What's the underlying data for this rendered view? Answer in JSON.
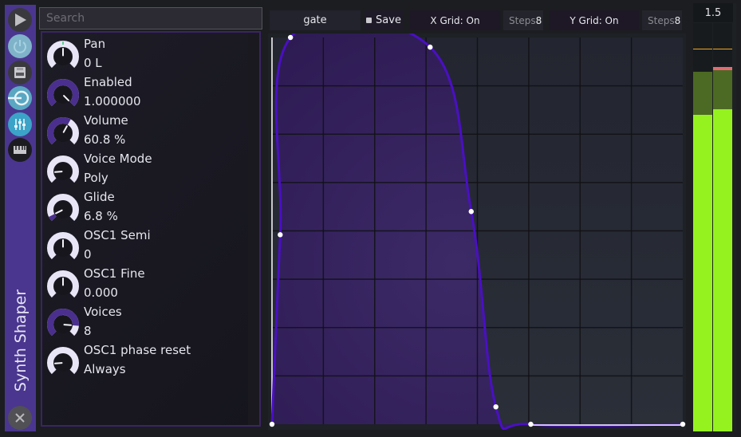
{
  "plugin": {
    "title": "Synth Shaper"
  },
  "side_strip": {
    "buttons": [
      {
        "name": "play",
        "icon": "play-icon"
      },
      {
        "name": "power",
        "icon": "power-icon"
      },
      {
        "name": "save",
        "icon": "floppy-disk-icon"
      },
      {
        "name": "routing",
        "icon": "input-routing-icon"
      },
      {
        "name": "mixer",
        "icon": "sliders-icon"
      },
      {
        "name": "keyboard",
        "icon": "piano-keyboard-icon"
      }
    ],
    "close_icon": "close-icon"
  },
  "search": {
    "placeholder": "Search",
    "value": ""
  },
  "params": [
    {
      "name": "Pan",
      "value": "0 L",
      "fill": 0.5,
      "style": "bipolar"
    },
    {
      "name": "Enabled",
      "value": "1.000000",
      "fill": 1.0,
      "style": "unipolar"
    },
    {
      "name": "Volume",
      "value": "60.8 %",
      "fill": 0.608,
      "style": "unipolar"
    },
    {
      "name": "Voice Mode",
      "value": "Poly",
      "fill": 0.15,
      "style": "none"
    },
    {
      "name": "Glide",
      "value": "6.8 %",
      "fill": 0.068,
      "style": "unipolar"
    },
    {
      "name": "OSC1 Semi",
      "value": "0",
      "fill": 0.5,
      "style": "none"
    },
    {
      "name": "OSC1 Fine",
      "value": "0.000",
      "fill": 0.5,
      "style": "none"
    },
    {
      "name": "Voices",
      "value": "8",
      "fill": 0.85,
      "style": "unipolar"
    },
    {
      "name": "OSC1 phase reset",
      "value": "Always",
      "fill": 0.15,
      "style": "none"
    }
  ],
  "toolbar": {
    "preset_name": "gate",
    "save_label": "Save",
    "x_grid_label": "X Grid: On",
    "x_steps_label": "Steps",
    "x_steps_value": "8",
    "y_grid_label": "Y Grid: On",
    "y_steps_label": "Steps",
    "y_steps_value": "8"
  },
  "shape": {
    "grid_x_steps": 8,
    "grid_y_steps": 8,
    "points": [
      {
        "x": 0.0,
        "y": 0.0
      },
      {
        "x": 0.02,
        "y": 0.49
      },
      {
        "x": 0.045,
        "y": 1.0
      },
      {
        "x": 0.385,
        "y": 0.975
      },
      {
        "x": 0.485,
        "y": 0.55
      },
      {
        "x": 0.545,
        "y": 0.045
      },
      {
        "x": 0.63,
        "y": 0.0
      },
      {
        "x": 1.0,
        "y": 0.0
      }
    ],
    "curve_color": "#4a0fc4",
    "fill_color": "#3b2466"
  },
  "meter": {
    "readout": "1.5",
    "channels": [
      {
        "level": 0.775,
        "hold": 0.88,
        "peak": 0.935,
        "clip": false
      },
      {
        "level": 0.79,
        "hold": 0.885,
        "peak": 0.935,
        "clip": true
      }
    ],
    "colors": {
      "level": "#96f21f",
      "hold": "#4c6a23",
      "peak": "#f2a41c",
      "clip": "#e36b74"
    }
  }
}
